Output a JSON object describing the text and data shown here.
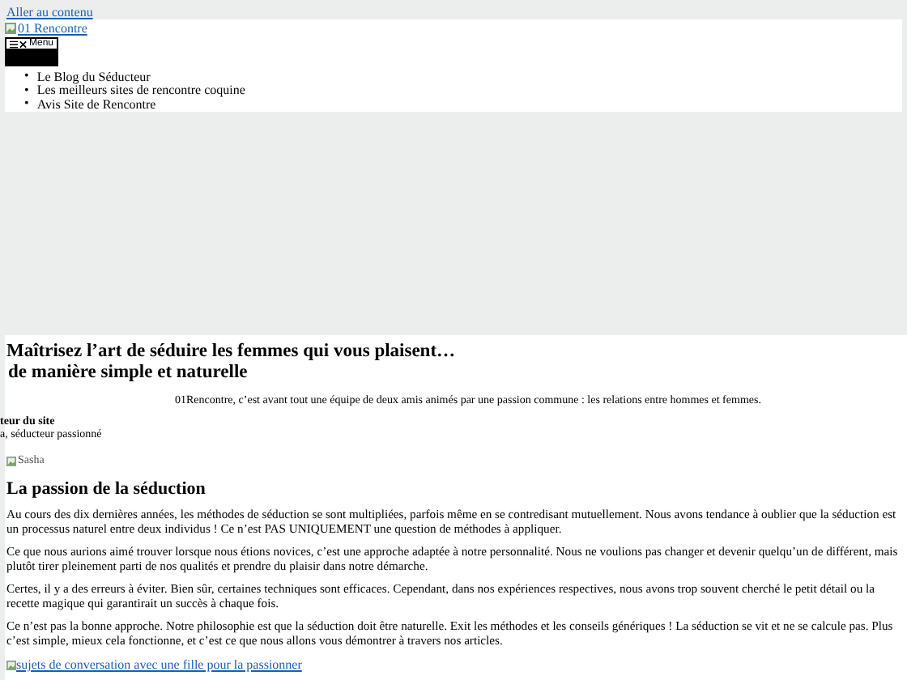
{
  "skip_link": "Aller au contenu",
  "header": {
    "logo_alt": "01 Rencontre",
    "menu_button": "Menu",
    "nav_items": [
      {
        "marker": "•",
        "label": "Le Blog du Séducteur"
      },
      {
        "marker": "•",
        "label": "Les meilleurs sites de rencontre coquine"
      },
      {
        "marker": "•",
        "label": "Avis Site de Rencontre"
      }
    ]
  },
  "hero": {
    "title_lines": [
      "Maîtrisez l’art de séduire les femmes qui vous plaisent…",
      "de manière simple et naturelle"
    ],
    "intro": "01Rencontre, c’est avant tout une équipe de deux amis animés par une passion commune : les relations entre hommes et femmes.",
    "author_title": "teur du site",
    "author_subtitle": "a, séducteur passionné",
    "author_image_alt": "Sasha"
  },
  "section": {
    "heading": "La passion de la séduction",
    "paragraphs": [
      "Au cours des dix dernières années, les méthodes de séduction se sont multipliées, parfois même en se contredisant mutuellement. Nous avons tendance à oublier que la séduction est un processus naturel entre deux individus ! Ce n’est PAS UNIQUEMENT une question de méthodes à appliquer.",
      "Ce que nous aurions aimé trouver lorsque nous étions novices, c’est une approche adaptée à notre personnalité. Nous ne voulions pas changer et devenir quelqu’un de différent, mais plutôt tirer pleinement parti de nos qualités et prendre du plaisir dans notre démarche.",
      "Certes, il y a des erreurs à éviter. Bien sûr, certaines techniques sont efficaces. Cependant, dans nos expériences respectives, nous avons trop souvent cherché le petit détail ou la recette magique qui garantirait un succès à chaque fois.",
      "Ce n’est pas la bonne approche. Notre philosophie est que la séduction doit être naturelle. Exit les méthodes et les conseils génériques ! La séduction se vit et ne se calcule pas. Plus c’est simple, mieux cela fonctionne, et c’est ce que nous allons vous démontrer à travers nos articles."
    ],
    "image_link_alt": "sujets de conversation avec une fille pour la passionner"
  }
}
